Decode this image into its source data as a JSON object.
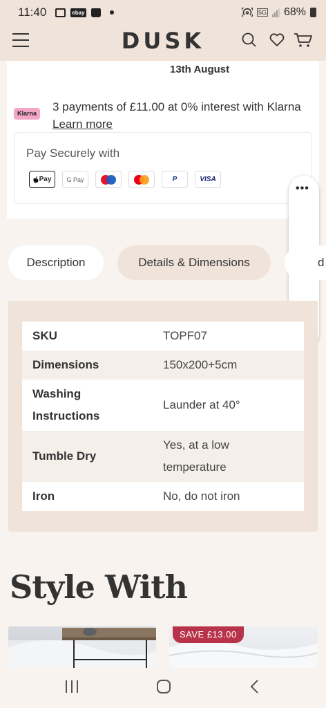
{
  "status": {
    "time": "11:40",
    "network": "5G",
    "battery": "68%"
  },
  "header": {
    "logo": "DUSK"
  },
  "delivery": {
    "date": "13th August"
  },
  "klarna": {
    "badge": "Klarna",
    "text": "3 payments of £11.00 at 0% interest with Klarna ",
    "link": "Learn more"
  },
  "payment": {
    "title": "Pay Securely with",
    "methods": [
      "Pay",
      "G Pay",
      "",
      "",
      "P",
      "VISA"
    ]
  },
  "tabs": [
    {
      "label": "Description"
    },
    {
      "label": "Details & Dimensions"
    },
    {
      "label": "d"
    }
  ],
  "details": {
    "rows": [
      {
        "label": "SKU",
        "value": "TOPF07"
      },
      {
        "label": "Dimensions",
        "value": "150x200+5cm"
      },
      {
        "label": "Washing Instructions",
        "value": "Launder at 40°"
      },
      {
        "label": "Tumble Dry",
        "value": "Yes, at a low temperature"
      },
      {
        "label": "Iron",
        "value": "No, do not iron"
      }
    ]
  },
  "style_with": {
    "heading": "Style With",
    "badge": "SAVE £13.00"
  },
  "colors": {
    "header_bg": "#efe3da",
    "page_bg": "#f8f3ef",
    "save_badge": "#b8334a",
    "klarna_pink": "#f4a6c6"
  }
}
